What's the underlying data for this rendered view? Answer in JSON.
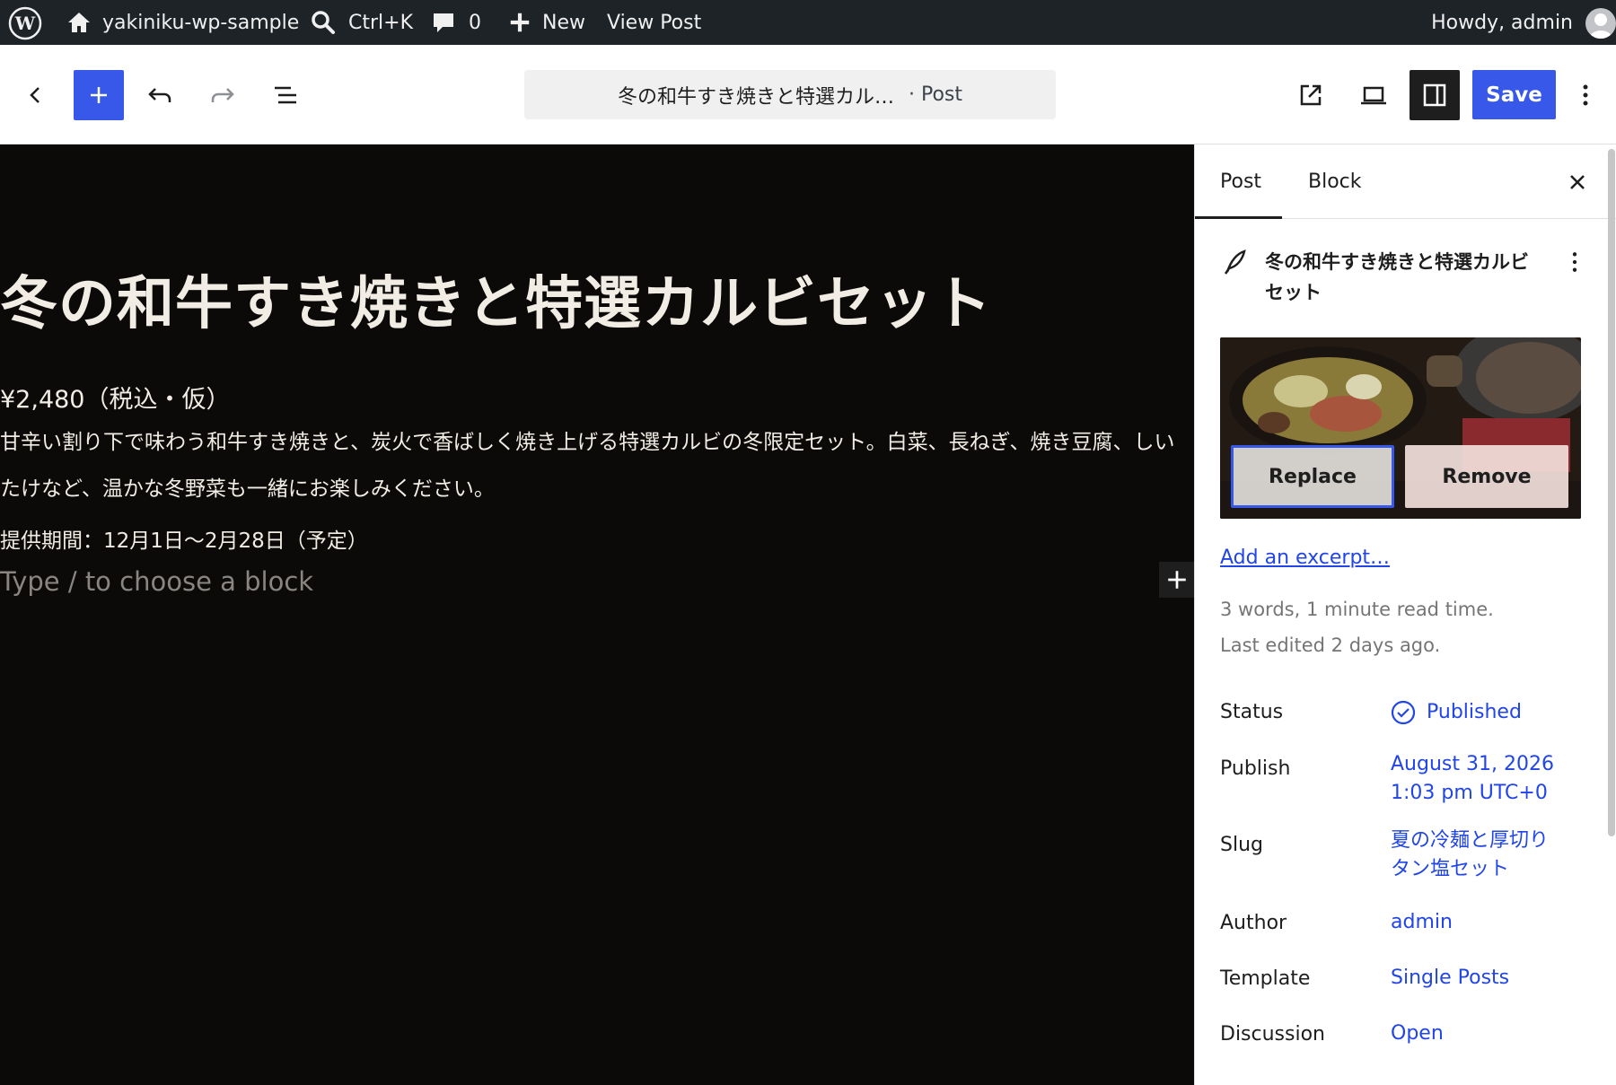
{
  "adminbar": {
    "site_name": "yakiniku-wp-sample",
    "search_shortcut": "Ctrl+K",
    "comments_count": "0",
    "new_label": "New",
    "view_post": "View Post",
    "howdy": "Howdy, admin"
  },
  "header": {
    "doc_title": "冬の和牛すき焼きと特選カル…",
    "post_type": "· Post",
    "save_label": "Save"
  },
  "content": {
    "title": "冬の和牛すき焼きと特選カルビセット",
    "price": "¥2,480（税込・仮）",
    "description": "甘辛い割り下で味わう和牛すき焼きと、炭火で香ばしく焼き上げる特選カルビの冬限定セット。白菜、長ねぎ、焼き豆腐、しいたけなど、温かな冬野菜も一緒にお楽しみください。",
    "period": "提供期間：12月1日〜2月28日（予定）",
    "placeholder": "Type / to choose a block"
  },
  "sidebar": {
    "tabs": [
      "Post",
      "Block"
    ],
    "active_tab": "Post",
    "summary_title": "冬の和牛すき焼きと特選カルビセット",
    "replace_label": "Replace",
    "remove_label": "Remove",
    "excerpt_link": "Add an excerpt…",
    "word_count": "3 words, 1 minute read time.",
    "last_edited": "Last edited 2 days ago.",
    "rows": {
      "status": {
        "label": "Status",
        "value": "Published"
      },
      "publish": {
        "label": "Publish",
        "value_line1": "August 31, 2026",
        "value_line2": "1:03 pm UTC+0"
      },
      "slug": {
        "label": "Slug",
        "value_line1": "夏の冷麺と厚切り",
        "value_line2": "タン塩セット"
      },
      "author": {
        "label": "Author",
        "value": "admin"
      },
      "template": {
        "label": "Template",
        "value": "Single Posts"
      },
      "discussion": {
        "label": "Discussion",
        "value": "Open"
      }
    }
  },
  "colors": {
    "accent": "#3858e9",
    "adminbar_bg": "#1d2327",
    "canvas_bg": "#0b0a09",
    "link": "#2145e6"
  }
}
